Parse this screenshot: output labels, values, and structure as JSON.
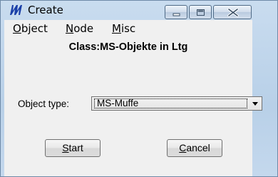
{
  "window": {
    "title": "Create",
    "controls": [
      "minimize-icon",
      "maximize-icon",
      "close-icon"
    ]
  },
  "menu": {
    "object": "Object",
    "node": "Node",
    "misc": "Misc"
  },
  "form": {
    "class_label": "Class:MS-Objekte in Ltg",
    "object_type_label": "Object type:",
    "object_type_value": "MS-Muffe"
  },
  "buttons": {
    "start": "Start",
    "cancel": "Cancel"
  },
  "colors": {
    "frame": "#c9dcef",
    "client": "#f0f0f0",
    "app_icon": "#1a3fa8"
  }
}
